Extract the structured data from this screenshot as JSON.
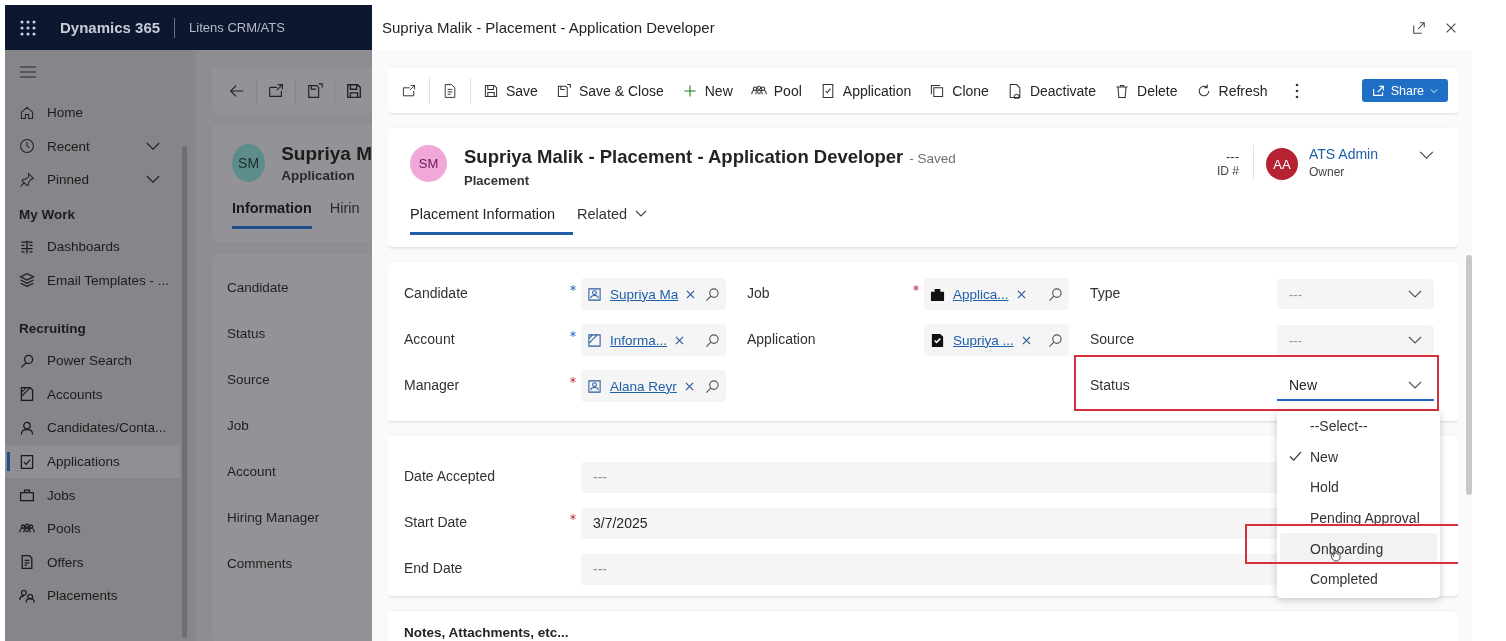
{
  "app_header": {
    "product": "Dynamics 365",
    "app_name": "Litens CRM/ATS"
  },
  "sidebar": {
    "top_items": [
      {
        "label": "Home",
        "expandable": false
      },
      {
        "label": "Recent",
        "expandable": true
      },
      {
        "label": "Pinned",
        "expandable": true
      }
    ],
    "groups": [
      {
        "title": "My Work",
        "items": [
          {
            "label": "Dashboards",
            "selected": false
          },
          {
            "label": "Email Templates - ...",
            "selected": false
          }
        ]
      },
      {
        "title": "Recruiting",
        "items": [
          {
            "label": "Power Search",
            "selected": false
          },
          {
            "label": "Accounts",
            "selected": false
          },
          {
            "label": "Candidates/Conta...",
            "selected": false
          },
          {
            "label": "Applications",
            "selected": true
          },
          {
            "label": "Jobs",
            "selected": false
          },
          {
            "label": "Pools",
            "selected": false
          },
          {
            "label": "Offers",
            "selected": false
          },
          {
            "label": "Placements",
            "selected": false
          }
        ]
      }
    ]
  },
  "background_record": {
    "avatar": "SM",
    "name": "Supriya M",
    "type": "Application",
    "tabs": [
      {
        "label": "Information",
        "selected": true
      },
      {
        "label": "Hirin",
        "selected": false
      }
    ],
    "fields": [
      "Candidate",
      "Status",
      "Source",
      "Job",
      "Account",
      "Hiring Manager",
      "Comments"
    ]
  },
  "panel": {
    "title": "Supriya Malik - Placement - Application Developer"
  },
  "command_bar": {
    "commands": [
      "Save",
      "Save & Close",
      "New",
      "Pool",
      "Application",
      "Clone",
      "Deactivate",
      "Delete",
      "Refresh"
    ],
    "share": "Share"
  },
  "record_header": {
    "avatar": "SM",
    "title": "Supriya Malik - Placement - Application Developer",
    "save_status": "- Saved",
    "entity": "Placement",
    "id_value": "---",
    "id_label": "ID #",
    "owner_avatar": "AA",
    "owner_name": "ATS Admin",
    "owner_role": "Owner",
    "tabs": [
      {
        "label": "Placement Information",
        "selected": true,
        "has_menu": false
      },
      {
        "label": "Related",
        "selected": false,
        "has_menu": true
      }
    ]
  },
  "general_section": {
    "columns": [
      [
        {
          "label": "Candidate",
          "required": false,
          "recommended": true,
          "kind": "lookup",
          "value": "Supriya Ma"
        },
        {
          "label": "Account",
          "required": false,
          "recommended": true,
          "kind": "lookup",
          "value": "Informa..."
        },
        {
          "label": "Manager",
          "required": true,
          "recommended": false,
          "kind": "lookup",
          "value": "Alana Reyr"
        }
      ],
      [
        {
          "label": "Job",
          "required": true,
          "recommended": false,
          "kind": "lookup",
          "value": "Applica..."
        },
        {
          "label": "Application",
          "required": false,
          "recommended": false,
          "kind": "lookup",
          "value": "Supriya ..."
        }
      ],
      [
        {
          "label": "Type",
          "required": false,
          "recommended": false,
          "kind": "select",
          "placeholder": "---",
          "open": false,
          "highlighted": false
        },
        {
          "label": "Source",
          "required": false,
          "recommended": false,
          "kind": "select",
          "placeholder": "---",
          "open": false,
          "highlighted": false
        },
        {
          "label": "Status",
          "required": false,
          "recommended": false,
          "kind": "select",
          "value": "New",
          "open": true,
          "highlighted": true,
          "options": [
            {
              "label": "--Select--",
              "selected": false,
              "hovered": false,
              "highlighted": false
            },
            {
              "label": "New",
              "selected": true,
              "hovered": false,
              "highlighted": false
            },
            {
              "label": "Hold",
              "selected": false,
              "hovered": false,
              "highlighted": false
            },
            {
              "label": "Pending Approval",
              "selected": false,
              "hovered": false,
              "highlighted": false
            },
            {
              "label": "Onboarding",
              "selected": false,
              "hovered": true,
              "highlighted": true
            },
            {
              "label": "Completed",
              "selected": false,
              "hovered": false,
              "highlighted": false
            }
          ]
        }
      ]
    ]
  },
  "dates_section": {
    "fields": [
      {
        "label": "Date Accepted",
        "required": false,
        "recommended": false,
        "placeholder": "---"
      },
      {
        "label": "Start Date",
        "required": true,
        "recommended": false,
        "value": "3/7/2025"
      },
      {
        "label": "End Date",
        "required": false,
        "recommended": false,
        "placeholder": "---"
      }
    ]
  },
  "notes_section": {
    "title": "Notes, Attachments, etc..."
  }
}
